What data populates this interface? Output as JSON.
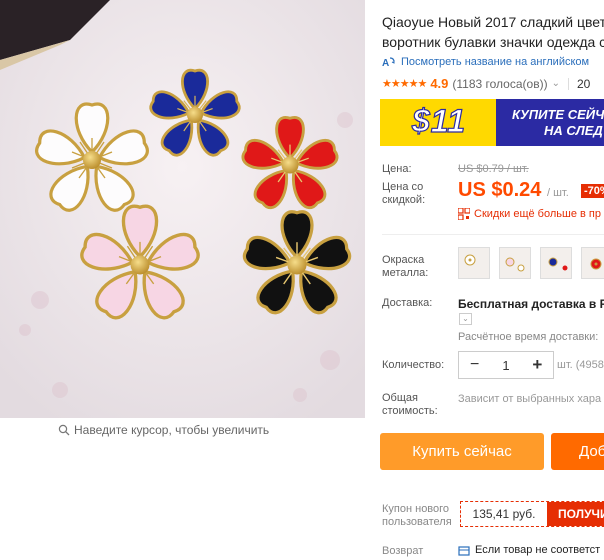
{
  "gallery": {
    "zoom_hint": "Наведите курсор, чтобы увеличить"
  },
  "product": {
    "title_line1": "Qiaoyue Новый 2017 сладкий цвето",
    "title_line2": "воротник булавки значки одежда с",
    "translate_link": "Посмотреть название на английском",
    "rating": "4.9",
    "votes": "(1183 голоса(ов))",
    "orders_stub": "20",
    "stars_count": 5
  },
  "promo": {
    "amount": "$11",
    "text_line1": "КУПИТЕ СЕЙЧА",
    "text_line2": "НА СЛЕД"
  },
  "price": {
    "label": "Цена:",
    "old": "US $0.79 / шт.",
    "discount_label": "Цена со скидкой:",
    "new": "US $0.24",
    "per_unit": "/ шт.",
    "discount": "-70%",
    "app_deal": "Скидки ещё больше в пр"
  },
  "options": {
    "metal_label": "Окраска металла:",
    "swatch_count": 4
  },
  "shipping": {
    "label": "Доставка:",
    "value": "Бесплатная доставка в Rus",
    "eta": "Расчётное время доставки:"
  },
  "quantity": {
    "label": "Количество:",
    "value": "1",
    "minus": "−",
    "plus": "+",
    "stock": "шт. (4958"
  },
  "total": {
    "label": "Общая стоимость:",
    "note": "Зависит от выбранных хара"
  },
  "actions": {
    "buy_now": "Купить сейчас",
    "add_to_cart": "Доб"
  },
  "coupon": {
    "label": "Купон нового пользователя",
    "amount": "135,41 руб.",
    "button": "ПОЛУЧИ"
  },
  "returns": {
    "label": "Возврат",
    "text": "Если товар не соответст"
  },
  "colors": {
    "accent_orange": "#ff6a00",
    "buy_orange": "#ff9b29",
    "sale_red": "#e62e04",
    "promo_blue": "#2b2aa3",
    "promo_yellow": "#ffd900",
    "link_blue": "#2a6ebb"
  }
}
